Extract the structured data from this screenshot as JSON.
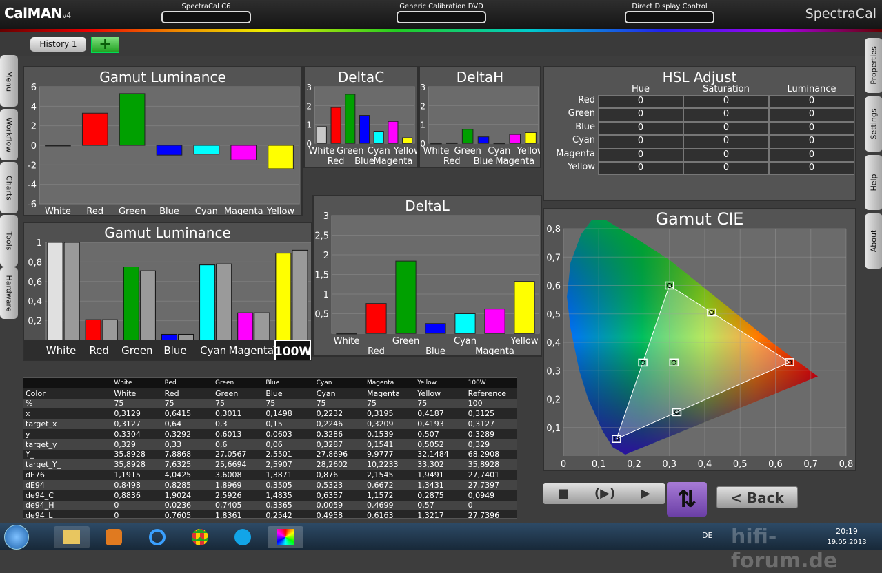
{
  "header": {
    "logo_main": "CalMAN",
    "logo_ver": "v4",
    "source1": "SpectraCal C6",
    "source2": "Generic Calibration DVD",
    "source3": "Direct Display Control",
    "brand": "SpectraCal"
  },
  "history": {
    "tab": "History 1",
    "add": "+"
  },
  "left_tabs": [
    "Menu",
    "Workflow",
    "Charts",
    "Tools",
    "Hardware"
  ],
  "right_tabs": [
    "Properties",
    "Settings",
    "Help",
    "About"
  ],
  "gamut_lum_top": {
    "title": "Gamut Luminance",
    "chart_data": {
      "type": "bar",
      "categories": [
        "White",
        "Red",
        "Green",
        "Blue",
        "Cyan",
        "Magenta",
        "Yellow"
      ],
      "values": [
        0.0,
        3.3,
        5.3,
        -1.0,
        -0.9,
        -1.5,
        -2.4
      ],
      "ylim": [
        -6,
        6
      ],
      "yticks": [
        "6",
        "4",
        "2",
        "0",
        "-2",
        "-4",
        "-6"
      ],
      "colors": [
        "#c8c8c8",
        "#ff0000",
        "#00a000",
        "#0000ff",
        "#00ffff",
        "#ff00ff",
        "#ffff00"
      ]
    }
  },
  "deltac": {
    "title": "DeltaC",
    "chart_data": {
      "type": "bar",
      "categories": [
        "White",
        "Red",
        "Green",
        "Blue",
        "Cyan",
        "Magenta",
        "Yellow"
      ],
      "values": [
        0.88,
        1.9,
        2.6,
        1.48,
        0.64,
        1.16,
        0.29
      ],
      "ylim": [
        0,
        3
      ],
      "yticks": [
        "3",
        "2",
        "1",
        "0"
      ],
      "labels_top": [
        "White",
        "Green",
        "Cyan",
        "Yellow"
      ],
      "labels_bottom": [
        "Red",
        "Blue",
        "Magenta"
      ]
    }
  },
  "deltah": {
    "title": "DeltaH",
    "chart_data": {
      "type": "bar",
      "categories": [
        "White",
        "Red",
        "Green",
        "Blue",
        "Cyan",
        "Magenta",
        "Yellow"
      ],
      "values": [
        0,
        0.02,
        0.74,
        0.34,
        0.01,
        0.47,
        0.57
      ],
      "ylim": [
        0,
        3
      ],
      "yticks": [
        "3",
        "2",
        "1",
        "0"
      ],
      "labels_top": [
        "White",
        "Green",
        "Cyan",
        "Yellow"
      ],
      "labels_bottom": [
        "Red",
        "Blue",
        "Magenta"
      ]
    }
  },
  "hsl": {
    "title": "HSL Adjust",
    "columns": [
      "Hue",
      "Saturation",
      "Luminance"
    ],
    "rows": [
      {
        "name": "Red",
        "values": [
          "0",
          "0",
          "0"
        ]
      },
      {
        "name": "Green",
        "values": [
          "0",
          "0",
          "0"
        ]
      },
      {
        "name": "Blue",
        "values": [
          "0",
          "0",
          "0"
        ]
      },
      {
        "name": "Cyan",
        "values": [
          "0",
          "0",
          "0"
        ]
      },
      {
        "name": "Magenta",
        "values": [
          "0",
          "0",
          "0"
        ]
      },
      {
        "name": "Yellow",
        "values": [
          "0",
          "0",
          "0"
        ]
      }
    ]
  },
  "gamut_lum_bot": {
    "title": "Gamut Luminance",
    "chart_data": {
      "type": "bar",
      "categories": [
        "White",
        "Red",
        "Green",
        "Blue",
        "Cyan",
        "Magenta",
        "Yellow"
      ],
      "series": [
        {
          "values": [
            1.0,
            0.21,
            0.75,
            0.06,
            0.77,
            0.28,
            0.89
          ]
        },
        {
          "values": [
            1.0,
            0.21,
            0.71,
            0.06,
            0.78,
            0.28,
            0.92
          ]
        }
      ],
      "ylim": [
        0,
        1
      ],
      "yticks": [
        "1",
        "0,8",
        "0,6",
        "0,4",
        "0,2"
      ],
      "colors": [
        "#e0e0e0",
        "#ff0000",
        "#00a000",
        "#0000ff",
        "#00ffff",
        "#ff00ff",
        "#ffff00"
      ],
      "tick_labels": [
        "White",
        "Red",
        "Green",
        "Blue",
        "Cyan",
        "Magenta",
        "Yellow"
      ],
      "badge": "100W"
    }
  },
  "deltal": {
    "title": "DeltaL",
    "chart_data": {
      "type": "bar",
      "categories": [
        "White",
        "Red",
        "Green",
        "Blue",
        "Cyan",
        "Magenta",
        "Yellow"
      ],
      "values": [
        0,
        0.76,
        1.84,
        0.25,
        0.5,
        0.62,
        1.32
      ],
      "ylim": [
        0,
        3
      ],
      "yticks": [
        "3",
        "2,5",
        "2",
        "1,5",
        "1",
        "0,5"
      ],
      "labels_top": [
        "White",
        "Green",
        "Cyan",
        "Yellow"
      ],
      "labels_bottom": [
        "Red",
        "Blue",
        "Magenta"
      ]
    }
  },
  "cie": {
    "title": "Gamut CIE",
    "chart_data": {
      "type": "scatter",
      "xlim": [
        0,
        0.8
      ],
      "ylim": [
        0,
        0.8
      ],
      "xticks": [
        "0",
        "0,1",
        "0,2",
        "0,3",
        "0,4",
        "0,5",
        "0,6",
        "0,7",
        "0,8"
      ],
      "yticks": [
        "0,8",
        "0,7",
        "0,6",
        "0,5",
        "0,4",
        "0,3",
        "0,2",
        "0,1"
      ],
      "targets": [
        {
          "name": "Red",
          "x": 0.64,
          "y": 0.33
        },
        {
          "name": "Green",
          "x": 0.3,
          "y": 0.6
        },
        {
          "name": "Blue",
          "x": 0.15,
          "y": 0.06
        },
        {
          "name": "Cyan",
          "x": 0.2246,
          "y": 0.3287
        },
        {
          "name": "Magenta",
          "x": 0.3209,
          "y": 0.1541
        },
        {
          "name": "Yellow",
          "x": 0.4193,
          "y": 0.5052
        },
        {
          "name": "White",
          "x": 0.3127,
          "y": 0.329
        }
      ]
    }
  },
  "table": {
    "top_row": [
      "",
      "White",
      "Red",
      "Green",
      "Blue",
      "Cyan",
      "Magenta",
      "Yellow",
      "100W"
    ],
    "rows": [
      [
        "Color",
        "White",
        "Red",
        "Green",
        "Blue",
        "Cyan",
        "Magenta",
        "Yellow",
        "Reference"
      ],
      [
        "%",
        "75",
        "75",
        "75",
        "75",
        "75",
        "75",
        "75",
        "100"
      ],
      [
        "x",
        "0,3129",
        "0,6415",
        "0,3011",
        "0,1498",
        "0,2232",
        "0,3195",
        "0,4187",
        "0,3125"
      ],
      [
        "target_x",
        "0,3127",
        "0,64",
        "0,3",
        "0,15",
        "0,2246",
        "0,3209",
        "0,4193",
        "0,3127"
      ],
      [
        "y",
        "0,3304",
        "0,3292",
        "0,6013",
        "0,0603",
        "0,3286",
        "0,1539",
        "0,507",
        "0,3289"
      ],
      [
        "target_y",
        "0,329",
        "0,33",
        "0,6",
        "0,06",
        "0,3287",
        "0,1541",
        "0,5052",
        "0,329"
      ],
      [
        "Y_",
        "35,8928",
        "7,8868",
        "27,0567",
        "2,5501",
        "27,8696",
        "9,9777",
        "32,1484",
        "68,2908"
      ],
      [
        "target_Y_",
        "35,8928",
        "7,6325",
        "25,6694",
        "2,5907",
        "28,2602",
        "10,2233",
        "33,302",
        "35,8928"
      ],
      [
        "dE76",
        "1,1915",
        "4,0425",
        "3,6008",
        "1,3871",
        "0,876",
        "2,1545",
        "1,9491",
        "27,7401"
      ],
      [
        "dE94",
        "0,8498",
        "0,8285",
        "1,8969",
        "0,3505",
        "0,5323",
        "0,6672",
        "1,3431",
        "27,7397"
      ],
      [
        "de94_C",
        "0,8836",
        "1,9024",
        "2,5926",
        "1,4835",
        "0,6357",
        "1,1572",
        "0,2875",
        "0,0949"
      ],
      [
        "de94_H",
        "0",
        "0,0236",
        "0,7405",
        "0,3365",
        "0,0059",
        "0,4699",
        "0,57",
        "0"
      ],
      [
        "de94_L",
        "0",
        "0,7605",
        "1,8361",
        "0,2542",
        "0,4958",
        "0,6163",
        "1,3217",
        "27,7396"
      ]
    ]
  },
  "controls": {
    "stop": "■",
    "play_loop": "(▶)",
    "play": "▶",
    "swap": "⇅",
    "back": "< Back"
  },
  "taskbar": {
    "lang": "DE",
    "time": "20:19",
    "date": "19.05.2013",
    "watermark": "hifi-forum.de"
  }
}
